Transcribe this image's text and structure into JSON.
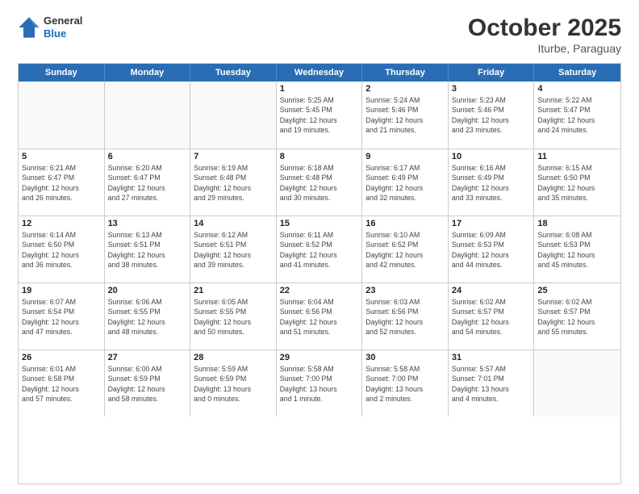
{
  "header": {
    "logo_general": "General",
    "logo_blue": "Blue",
    "month_title": "October 2025",
    "location": "Iturbe, Paraguay"
  },
  "weekdays": [
    "Sunday",
    "Monday",
    "Tuesday",
    "Wednesday",
    "Thursday",
    "Friday",
    "Saturday"
  ],
  "weeks": [
    [
      {
        "day": "",
        "info": ""
      },
      {
        "day": "",
        "info": ""
      },
      {
        "day": "",
        "info": ""
      },
      {
        "day": "1",
        "info": "Sunrise: 5:25 AM\nSunset: 5:45 PM\nDaylight: 12 hours\nand 19 minutes."
      },
      {
        "day": "2",
        "info": "Sunrise: 5:24 AM\nSunset: 5:46 PM\nDaylight: 12 hours\nand 21 minutes."
      },
      {
        "day": "3",
        "info": "Sunrise: 5:23 AM\nSunset: 5:46 PM\nDaylight: 12 hours\nand 23 minutes."
      },
      {
        "day": "4",
        "info": "Sunrise: 5:22 AM\nSunset: 5:47 PM\nDaylight: 12 hours\nand 24 minutes."
      }
    ],
    [
      {
        "day": "5",
        "info": "Sunrise: 6:21 AM\nSunset: 6:47 PM\nDaylight: 12 hours\nand 26 minutes."
      },
      {
        "day": "6",
        "info": "Sunrise: 6:20 AM\nSunset: 6:47 PM\nDaylight: 12 hours\nand 27 minutes."
      },
      {
        "day": "7",
        "info": "Sunrise: 6:19 AM\nSunset: 6:48 PM\nDaylight: 12 hours\nand 29 minutes."
      },
      {
        "day": "8",
        "info": "Sunrise: 6:18 AM\nSunset: 6:48 PM\nDaylight: 12 hours\nand 30 minutes."
      },
      {
        "day": "9",
        "info": "Sunrise: 6:17 AM\nSunset: 6:49 PM\nDaylight: 12 hours\nand 32 minutes."
      },
      {
        "day": "10",
        "info": "Sunrise: 6:16 AM\nSunset: 6:49 PM\nDaylight: 12 hours\nand 33 minutes."
      },
      {
        "day": "11",
        "info": "Sunrise: 6:15 AM\nSunset: 6:50 PM\nDaylight: 12 hours\nand 35 minutes."
      }
    ],
    [
      {
        "day": "12",
        "info": "Sunrise: 6:14 AM\nSunset: 6:50 PM\nDaylight: 12 hours\nand 36 minutes."
      },
      {
        "day": "13",
        "info": "Sunrise: 6:13 AM\nSunset: 6:51 PM\nDaylight: 12 hours\nand 38 minutes."
      },
      {
        "day": "14",
        "info": "Sunrise: 6:12 AM\nSunset: 6:51 PM\nDaylight: 12 hours\nand 39 minutes."
      },
      {
        "day": "15",
        "info": "Sunrise: 6:11 AM\nSunset: 6:52 PM\nDaylight: 12 hours\nand 41 minutes."
      },
      {
        "day": "16",
        "info": "Sunrise: 6:10 AM\nSunset: 6:52 PM\nDaylight: 12 hours\nand 42 minutes."
      },
      {
        "day": "17",
        "info": "Sunrise: 6:09 AM\nSunset: 6:53 PM\nDaylight: 12 hours\nand 44 minutes."
      },
      {
        "day": "18",
        "info": "Sunrise: 6:08 AM\nSunset: 6:53 PM\nDaylight: 12 hours\nand 45 minutes."
      }
    ],
    [
      {
        "day": "19",
        "info": "Sunrise: 6:07 AM\nSunset: 6:54 PM\nDaylight: 12 hours\nand 47 minutes."
      },
      {
        "day": "20",
        "info": "Sunrise: 6:06 AM\nSunset: 6:55 PM\nDaylight: 12 hours\nand 48 minutes."
      },
      {
        "day": "21",
        "info": "Sunrise: 6:05 AM\nSunset: 6:55 PM\nDaylight: 12 hours\nand 50 minutes."
      },
      {
        "day": "22",
        "info": "Sunrise: 6:04 AM\nSunset: 6:56 PM\nDaylight: 12 hours\nand 51 minutes."
      },
      {
        "day": "23",
        "info": "Sunrise: 6:03 AM\nSunset: 6:56 PM\nDaylight: 12 hours\nand 52 minutes."
      },
      {
        "day": "24",
        "info": "Sunrise: 6:02 AM\nSunset: 6:57 PM\nDaylight: 12 hours\nand 54 minutes."
      },
      {
        "day": "25",
        "info": "Sunrise: 6:02 AM\nSunset: 6:57 PM\nDaylight: 12 hours\nand 55 minutes."
      }
    ],
    [
      {
        "day": "26",
        "info": "Sunrise: 6:01 AM\nSunset: 6:58 PM\nDaylight: 12 hours\nand 57 minutes."
      },
      {
        "day": "27",
        "info": "Sunrise: 6:00 AM\nSunset: 6:59 PM\nDaylight: 12 hours\nand 58 minutes."
      },
      {
        "day": "28",
        "info": "Sunrise: 5:59 AM\nSunset: 6:59 PM\nDaylight: 13 hours\nand 0 minutes."
      },
      {
        "day": "29",
        "info": "Sunrise: 5:58 AM\nSunset: 7:00 PM\nDaylight: 13 hours\nand 1 minute."
      },
      {
        "day": "30",
        "info": "Sunrise: 5:58 AM\nSunset: 7:00 PM\nDaylight: 13 hours\nand 2 minutes."
      },
      {
        "day": "31",
        "info": "Sunrise: 5:57 AM\nSunset: 7:01 PM\nDaylight: 13 hours\nand 4 minutes."
      },
      {
        "day": "",
        "info": ""
      }
    ]
  ]
}
